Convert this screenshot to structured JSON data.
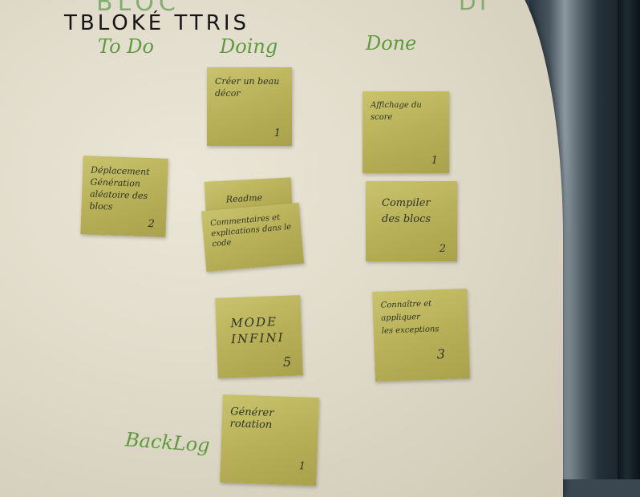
{
  "board": {
    "title": "TBLOKÉ TTRIS",
    "header_top_left": "BLOC",
    "header_top_right": "DT"
  },
  "columns": {
    "todo": "To Do",
    "doing": "Doing",
    "done": "Done",
    "backlog": "BackLog"
  },
  "notes": {
    "todo_1": {
      "text": "Déplacement\nGénération aléatoire des\nblocs",
      "points": "2"
    },
    "doing_1": {
      "text": "Créer un beau\ndécor",
      "points": "1"
    },
    "doing_2": {
      "text": "Readme",
      "points": ""
    },
    "doing_3": {
      "text": "Commentaires et\nexplications dans le code",
      "points": ""
    },
    "doing_4": {
      "text": "MODE\nINFINI",
      "points": "5"
    },
    "doing_5": {
      "text": "Générer rotation",
      "points": "1"
    },
    "done_1": {
      "text": "Affichage du score",
      "points": "1"
    },
    "done_2": {
      "text": "Compiler\ndes blocs",
      "points": "2"
    },
    "done_3": {
      "text": "Connaître et appliquer\nles exceptions",
      "points": "3"
    }
  },
  "colors": {
    "sticky_note": "#bdb65e",
    "column_label_green": "#5f9a3d",
    "paper": "#e3dfce",
    "window_frame": "#1f2b34"
  }
}
